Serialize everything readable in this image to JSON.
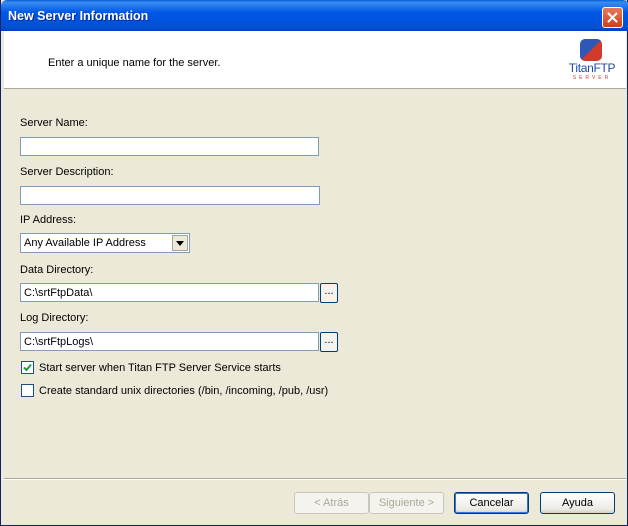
{
  "window": {
    "title": "New Server Information"
  },
  "header": {
    "instruction": "Enter a unique name for the server.",
    "logo": {
      "titan": "Titan",
      "ftp": "FTP",
      "sub": "SERVER"
    }
  },
  "form": {
    "server_name": {
      "label": "Server Name:",
      "value": ""
    },
    "server_description": {
      "label": "Server Description:",
      "value": ""
    },
    "ip_address": {
      "label": "IP Address:",
      "selected": "Any Available IP Address"
    },
    "data_directory": {
      "label": "Data Directory:",
      "value": "C:\\srtFtpData\\",
      "browse_label": "..."
    },
    "log_directory": {
      "label": "Log Directory:",
      "value": "C:\\srtFtpLogs\\",
      "browse_label": "..."
    },
    "start_server": {
      "label": "Start server when Titan FTP Server Service starts",
      "checked": true
    },
    "unix_dirs": {
      "label": "Create standard unix directories (/bin, /incoming, /pub, /usr)",
      "checked": false
    }
  },
  "buttons": {
    "back": "< Atrás",
    "next": "Siguiente >",
    "cancel": "Cancelar",
    "help": "Ayuda"
  },
  "colors": {
    "titlebar": "#0058e6",
    "close": "#c9401e",
    "dialog_bg": "#ece9d8"
  }
}
